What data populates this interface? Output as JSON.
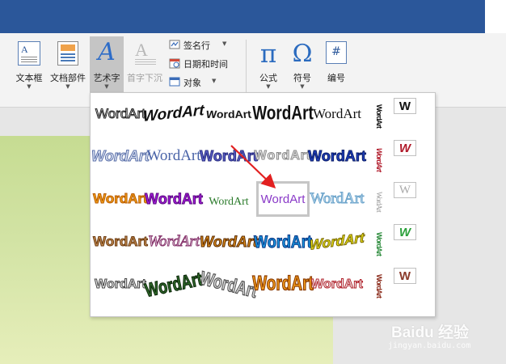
{
  "ribbon": {
    "text_box": "文本框",
    "quick_parts": "文档部件",
    "wordart": "艺术字",
    "drop_cap": "首字下沉",
    "signature_line": "签名行",
    "date_time": "日期和时间",
    "object": "对象",
    "equation": "公式",
    "symbol": "符号",
    "number": "编号"
  },
  "gallery": {
    "styles": [
      [
        "WordArt",
        "WordArt",
        "WordArt",
        "WordArt",
        "WordArt"
      ],
      [
        "WordArt",
        "WordArt",
        "WordArt",
        "WordArt",
        "WordArt"
      ],
      [
        "WordArt",
        "WordArt",
        "WordArt",
        "WordArt",
        "WordArt"
      ],
      [
        "WordArt",
        "WordArt",
        "WordArt",
        "WordArt",
        "WordArt"
      ],
      [
        "WordArt",
        "WordArt",
        "WordArt",
        "WordArt",
        "WordArt"
      ]
    ],
    "vertical": [
      "WordArt",
      "WordArt",
      "WordArt",
      "WordArt",
      "WordArt"
    ],
    "extra": [
      "W",
      "W",
      "W",
      "W",
      "W"
    ]
  },
  "watermark": {
    "brand": "Baidu 经验",
    "url": "jingyan.baidu.com"
  }
}
